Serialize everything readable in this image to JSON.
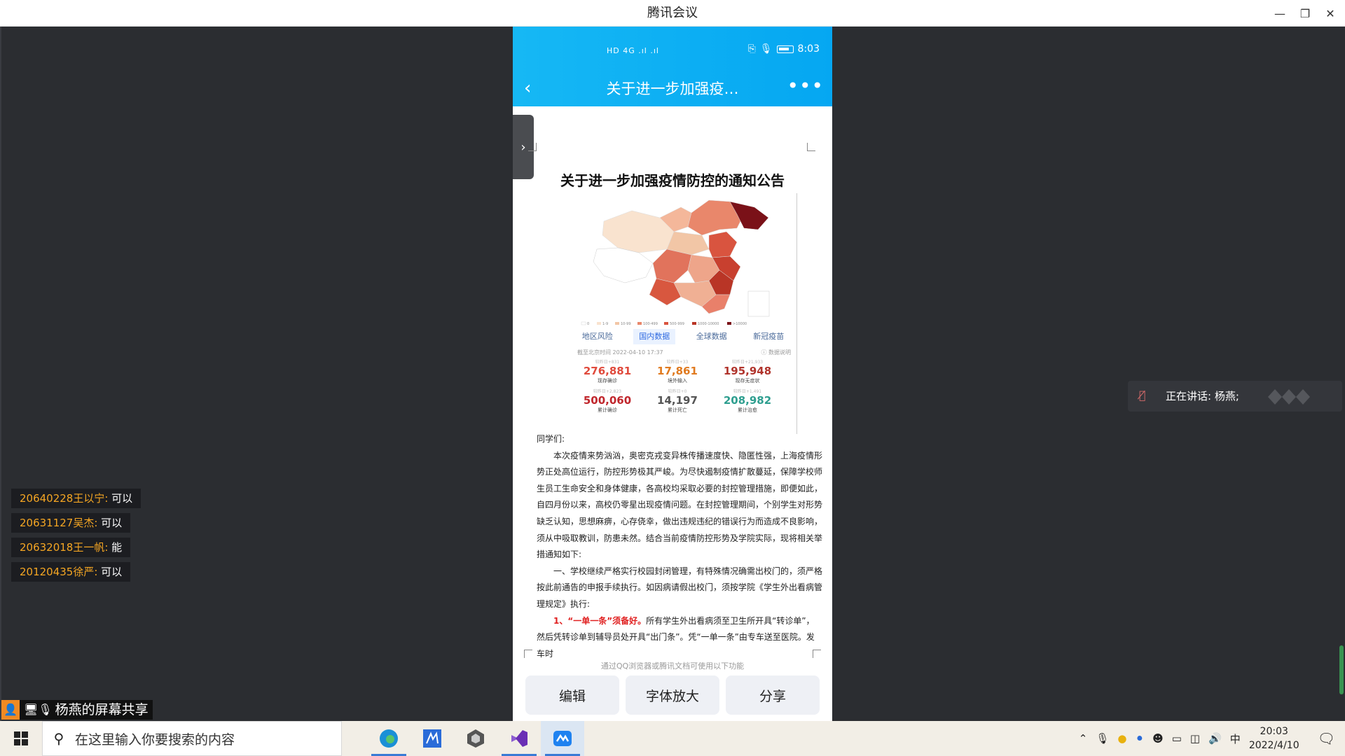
{
  "window": {
    "title": "腾讯会议"
  },
  "phone": {
    "status": {
      "signal": "HD 4G .ıl .ıl",
      "time": "8:03"
    },
    "nav": {
      "back": "‹",
      "title": "关于进一步加强疫…",
      "more": "•••"
    },
    "side_tab_icon": "›",
    "doc": {
      "title": "关于进一步加强疫情防控的通知公告",
      "map": {
        "tabs": [
          "地区风险",
          "国内数据",
          "全球数据",
          "新冠疫苗"
        ],
        "active_tab": 1,
        "as_of": "截至北京时间 2022-04-10 17:37",
        "data_note": "ⓘ 数据说明",
        "stats": [
          {
            "delta": "较昨日+831",
            "value": "276,881",
            "label": "现存确诊",
            "color": "#e04a3c"
          },
          {
            "delta": "较昨日+33",
            "value": "17,861",
            "label": "境外输入",
            "color": "#e07a1f"
          },
          {
            "delta": "较昨日+21,933",
            "value": "195,948",
            "label": "现存无症状",
            "color": "#b0342c"
          },
          {
            "delta": "较昨日+2,823",
            "value": "500,060",
            "label": "累计确诊",
            "color": "#c0262c"
          },
          {
            "delta": "较昨日+0",
            "value": "14,197",
            "label": "累计死亡",
            "color": "#555555"
          },
          {
            "delta": "较昨日+1,491",
            "value": "208,982",
            "label": "累计治愈",
            "color": "#2e9e8f"
          }
        ],
        "legend": [
          "0",
          "1-9",
          "10-99",
          "100-499",
          "500-999",
          "1000-10000",
          ">10000"
        ]
      },
      "greeting": "同学们:",
      "para1": "本次疫情来势汹汹，奥密克戎变异株传播速度快、隐匿性强，上海疫情形势正处高位运行，防控形势极其严峻。为尽快遏制疫情扩散蔓延，保障学校师生员工生命安全和身体健康，各高校均采取必要的封控管理措施，即便如此，自四月份以来，高校仍零星出现疫情问题。在封控管理期间，个别学生对形势缺乏认知，思想麻痹，心存侥幸，做出违规违纪的错误行为而造成不良影响，须从中吸取教训，防患未然。结合当前疫情防控形势及学院实际，现将相关举措通知如下:",
      "para2": "一、学校继续严格实行校园封闭管理，有特殊情况确需出校门的，须严格按此前通告的申报手续执行。如因病请假出校门，须按学院《学生外出看病管理规定》执行:",
      "para3_red": "1、“一单一条”须备好。",
      "para3": "所有学生外出看病须至卫生所开具“转诊单”，然后凭转诊单到辅导员处开具“出门条”。凭“一单一条”由专车送至医院。发车时",
      "footer_hint": "通过QQ浏览器或腾讯文档可使用以下功能",
      "buttons": [
        "编辑",
        "字体放大",
        "分享"
      ]
    }
  },
  "chat_messages": [
    {
      "who": "20640228王以宁:",
      "msg": " 可以"
    },
    {
      "who": "20631127吴杰:",
      "msg": " 可以"
    },
    {
      "who": "20632018王一帆:",
      "msg": " 能"
    },
    {
      "who": "20120435徐严:",
      "msg": " 可以"
    }
  ],
  "speaking": {
    "label": "正在讲话: 杨燕;"
  },
  "share_label": "杨燕的屏幕共享",
  "taskbar": {
    "search_placeholder": "在这里输入你要搜索的内容",
    "ime": "中",
    "time": "20:03",
    "date": "2022/4/10"
  }
}
